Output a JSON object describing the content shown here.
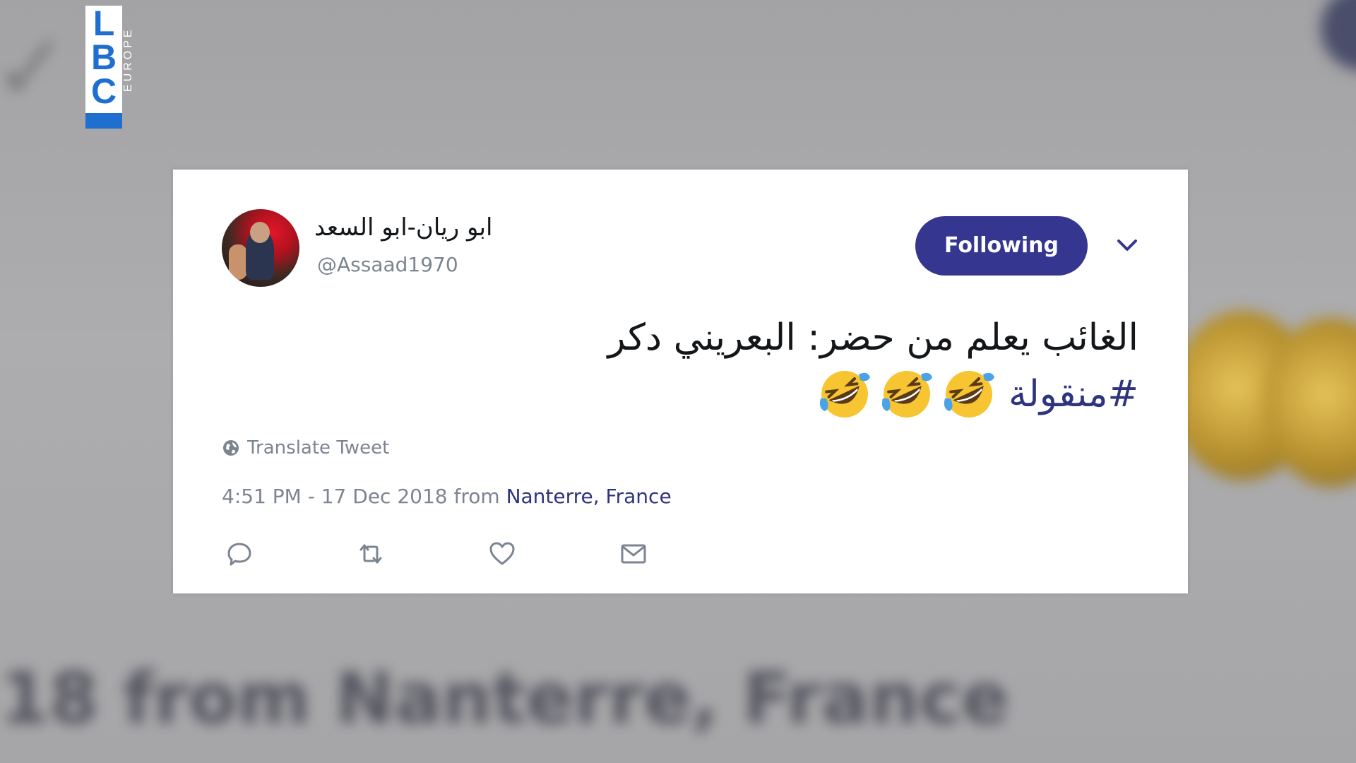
{
  "logo": {
    "letters": [
      "L",
      "B",
      "C"
    ],
    "subtitle": "EUROPE",
    "brand_color": "#1e6fcf"
  },
  "tweet": {
    "display_name": "ابو ريان-ابو السعد",
    "handle": "@Assaad1970",
    "follow_label": "Following",
    "follow_color": "#34368f",
    "text_line1": "الغائب يعلم من حضر: البعريني دكر",
    "hashtag": "#منقولة",
    "emojis": [
      "rolling-on-floor-laughing",
      "rolling-on-floor-laughing",
      "rolling-on-floor-laughing"
    ],
    "translate_label": "Translate Tweet",
    "timestamp": "4:51 PM - 17 Dec 2018 from",
    "location": "Nanterre, France",
    "actions": [
      "reply-icon",
      "retweet-icon",
      "like-icon",
      "message-icon"
    ]
  },
  "background": {
    "blur_bottom_text": "18 from Nanterre, France"
  }
}
